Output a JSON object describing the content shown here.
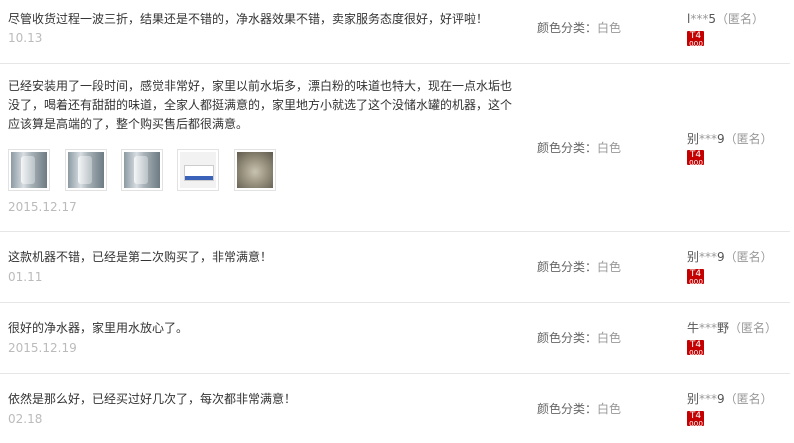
{
  "reviews": [
    {
      "text": "尽管收货过程一波三折，结果还是不错的，净水器效果不错，卖家服务态度很好，好评啦！",
      "date": "10.13",
      "color_label": "颜色分类：",
      "color_value": "白色",
      "user_first": "l",
      "user_stars": "***",
      "user_last": "5",
      "anon": "（匿名）",
      "badge": "T4",
      "images": []
    },
    {
      "text": "已经安装用了一段时间，感觉非常好，家里以前水垢多，漂白粉的味道也特大，现在一点水垢也没了，喝着还有甜甜的味道，全家人都挺满意的，家里地方小就选了这个没储水罐的机器，这个应该算是高端的了，整个购买售后都很满意。",
      "date": "2015.12.17",
      "color_label": "颜色分类：",
      "color_value": "白色",
      "user_first": "别",
      "user_stars": "***",
      "user_last": "9",
      "anon": "（匿名）",
      "badge": "T4",
      "images": [
        "pipe-fitting-photo",
        "pipe-fitting-photo",
        "pipe-fitting-photo",
        "product-box-photo",
        "tank-photo"
      ]
    },
    {
      "text": "这款机器不错，已经是第二次购买了，非常满意！",
      "date": "01.11",
      "color_label": "颜色分类：",
      "color_value": "白色",
      "user_first": "别",
      "user_stars": "***",
      "user_last": "9",
      "anon": "（匿名）",
      "badge": "T4",
      "images": []
    },
    {
      "text": "很好的净水器，家里用水放心了。",
      "date": "2015.12.19",
      "color_label": "颜色分类：",
      "color_value": "白色",
      "user_first": "牛",
      "user_stars": "***",
      "user_last": "野",
      "anon": "（匿名）",
      "badge": "T4",
      "images": []
    },
    {
      "text": "依然是那么好，已经买过好几次了，每次都非常满意！",
      "date": "02.18",
      "color_label": "颜色分类：",
      "color_value": "白色",
      "user_first": "别",
      "user_stars": "***",
      "user_last": "9",
      "anon": "（匿名）",
      "badge": "T4",
      "images": []
    }
  ]
}
